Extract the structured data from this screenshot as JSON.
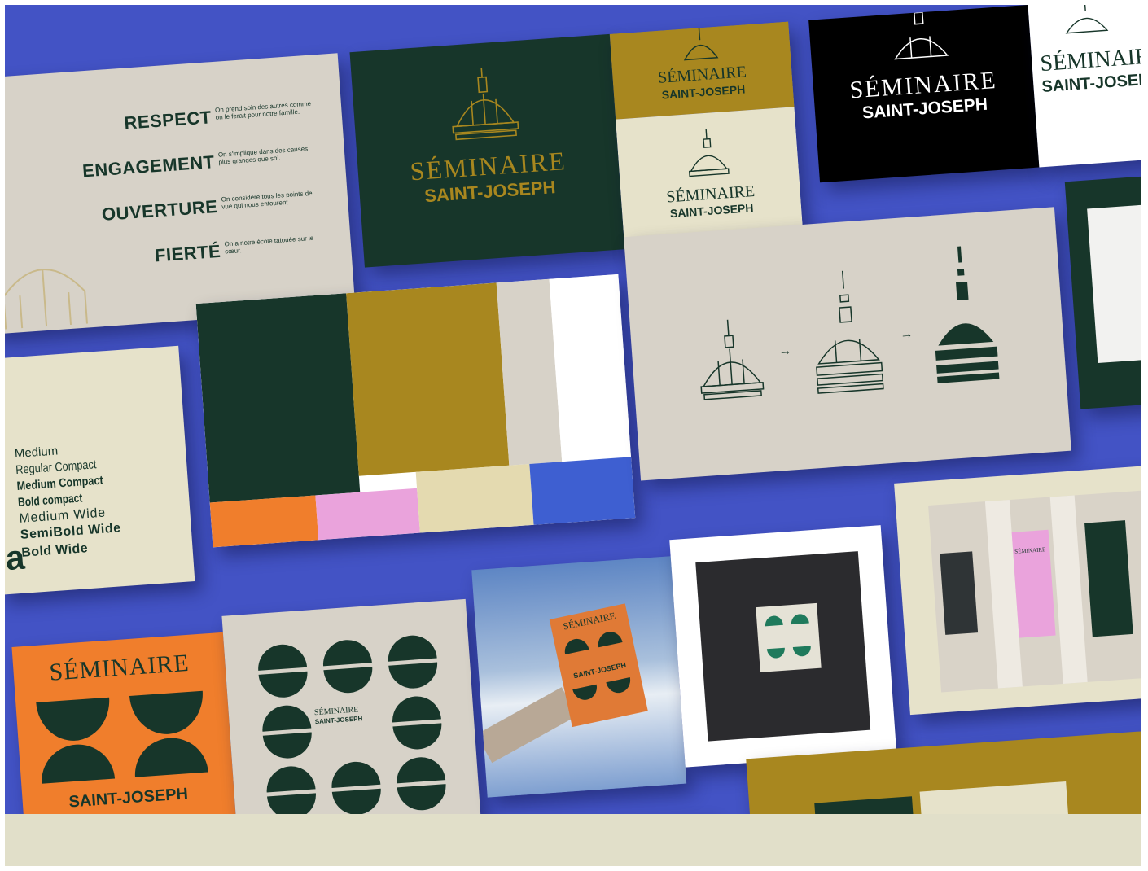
{
  "palette": {
    "background_blue": "#4353c5",
    "dark_green": "#17362a",
    "gold": "#a8871f",
    "cream": "#e6e2ca",
    "grey": "#d7d2c8",
    "orange": "#f07e2c",
    "pink": "#eaa3dc",
    "white": "#ffffff",
    "black": "#000000"
  },
  "brand": {
    "name_top": "SÉMINAIRE",
    "name_bottom": "SAINT-JOSEPH"
  },
  "values": [
    {
      "word": "RESPECT",
      "desc": "On prend soin des autres comme on le ferait pour notre famille."
    },
    {
      "word": "ENGAGEMENT",
      "desc": "On s'implique dans des causes plus grandes que soi."
    },
    {
      "word": "OUVERTURE",
      "desc": "On considère tous les points de vue qui nous entourent."
    },
    {
      "word": "FIERTÉ",
      "desc": "On a notre école tatouée sur le cœur."
    }
  ],
  "typography": {
    "weights": [
      "Medium",
      "Regular Compact",
      "Medium Compact",
      "Bold compact",
      "Medium Wide",
      "SemiBold Wide",
      "Bold Wide"
    ],
    "specimen_glyph": "a"
  },
  "icons": [
    "dome-outline-icon",
    "dome-stencil-icon",
    "dome-solid-icon",
    "arrow-right-icon"
  ],
  "arrows": [
    "→",
    "→"
  ],
  "photo_banner_label": "SÉMINAIRE"
}
